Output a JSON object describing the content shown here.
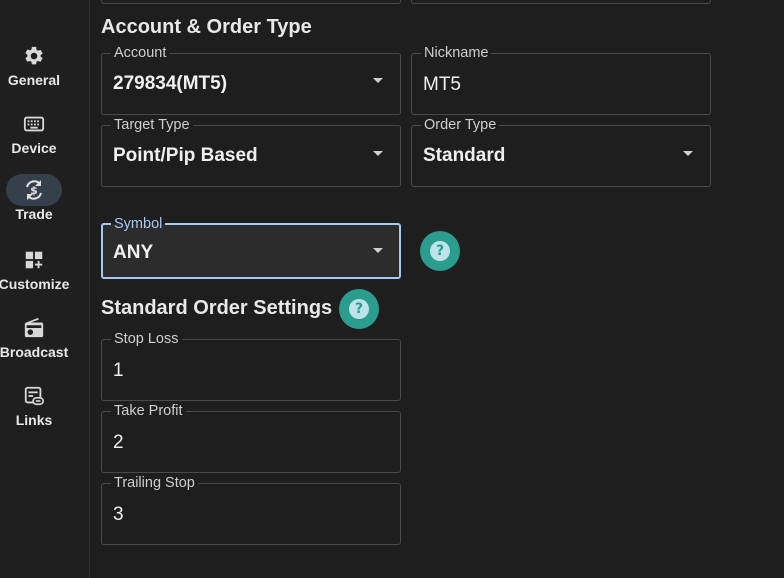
{
  "sidebar": {
    "items": [
      {
        "label": "General",
        "icon": "gear-icon"
      },
      {
        "label": "Device",
        "icon": "keyboard-icon"
      },
      {
        "label": "Trade",
        "icon": "currency-exchange-icon",
        "active": true
      },
      {
        "label": "Customize",
        "icon": "dashboard-customize-icon"
      },
      {
        "label": "Broadcast",
        "icon": "radio-icon"
      },
      {
        "label": "Links",
        "icon": "link-icon"
      }
    ]
  },
  "account_section": {
    "title": "Account & Order Type",
    "account": {
      "label": "Account",
      "value": "279834(MT5)"
    },
    "nickname": {
      "label": "Nickname",
      "value": "MT5"
    },
    "target_type": {
      "label": "Target Type",
      "value": "Point/Pip Based"
    },
    "order_type": {
      "label": "Order Type",
      "value": "Standard"
    },
    "symbol": {
      "label": "Symbol",
      "value": "ANY"
    },
    "help_glyph": "?"
  },
  "standard_section": {
    "title": "Standard Order Settings",
    "help_glyph": "?",
    "stop_loss": {
      "label": "Stop Loss",
      "value": "1"
    },
    "take_profit": {
      "label": "Take Profit",
      "value": "2"
    },
    "trailing_stop": {
      "label": "Trailing Stop",
      "value": "3"
    }
  },
  "colors": {
    "background": "#1e1e1e",
    "accent_teal": "#2a9d8f",
    "focus_blue": "#a9c8f2",
    "active_nav": "#35404a"
  }
}
